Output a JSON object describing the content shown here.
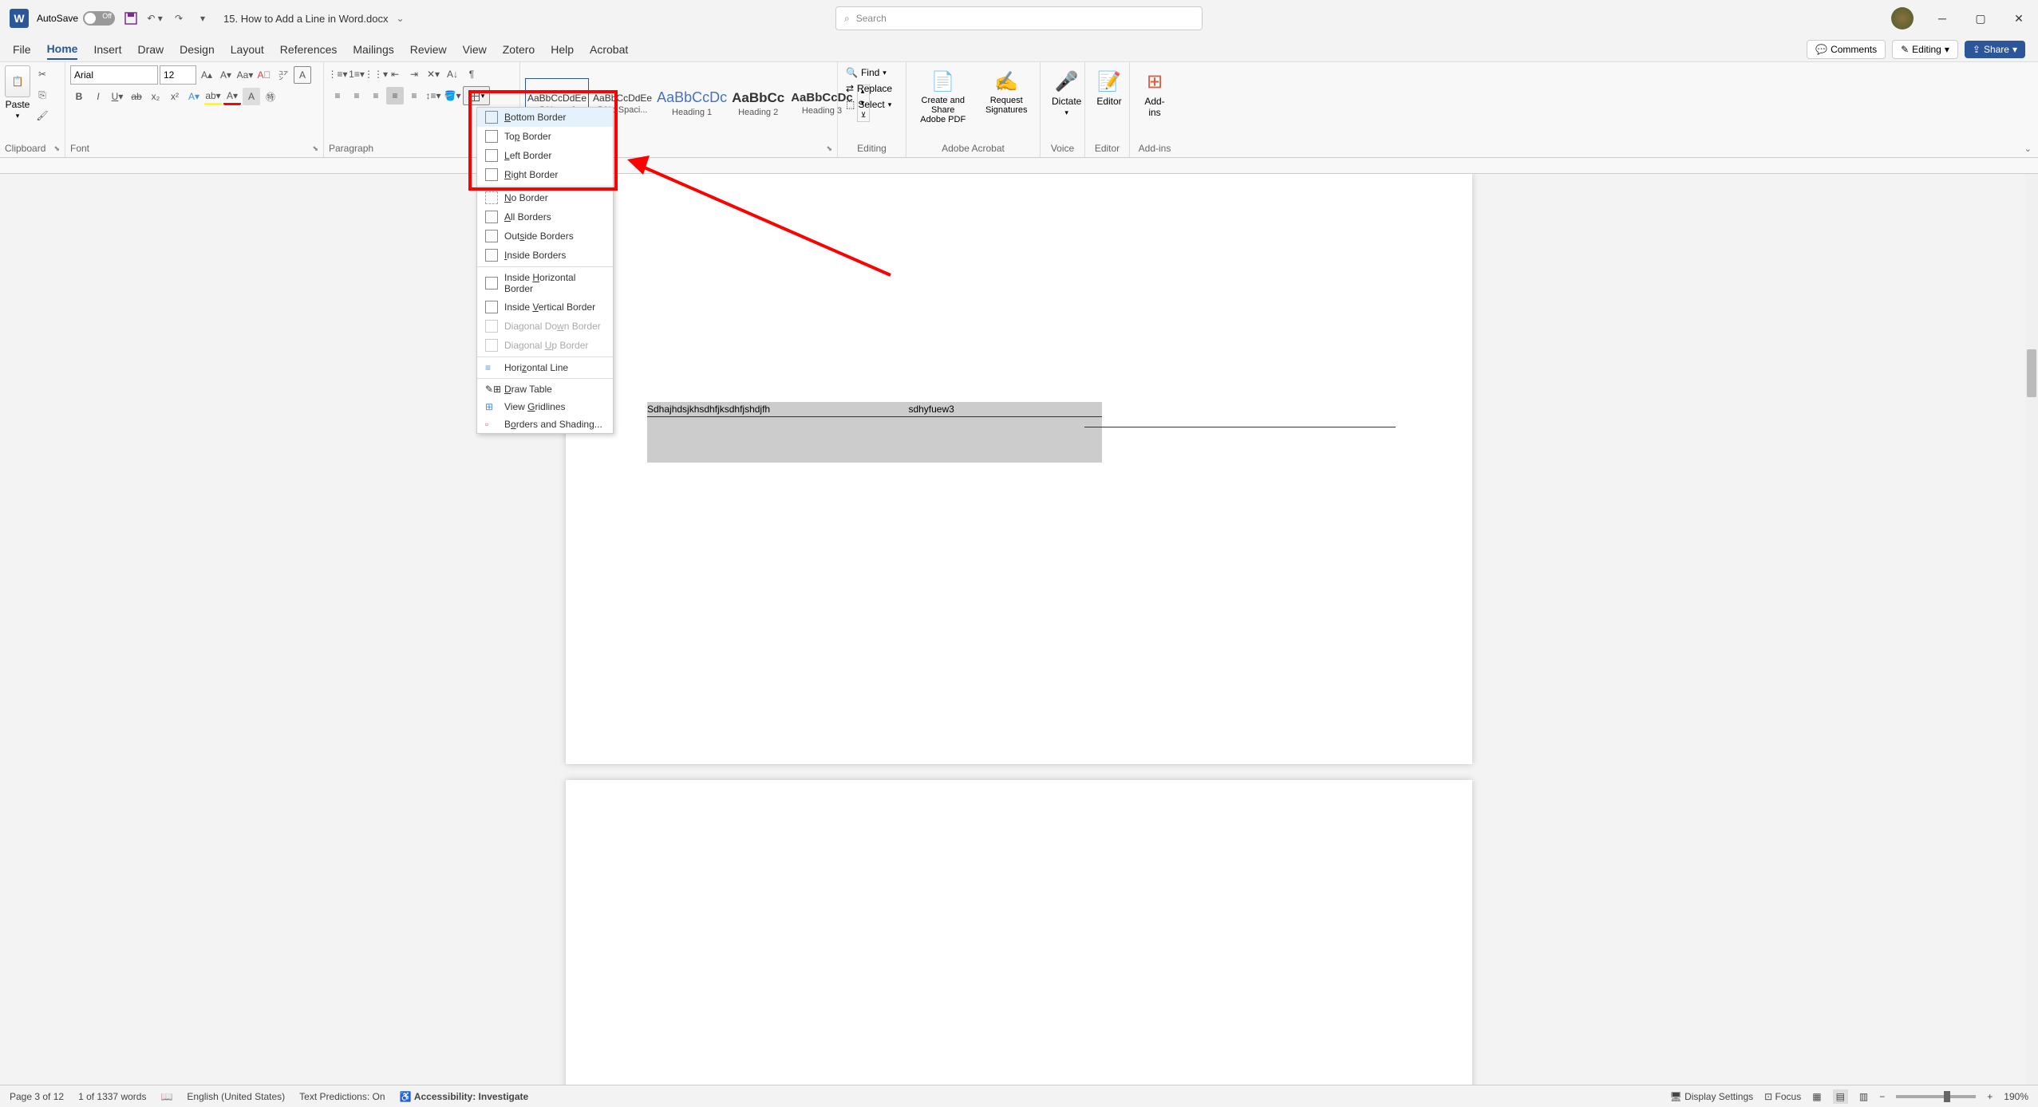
{
  "titlebar": {
    "autosave_label": "AutoSave",
    "autosave_state": "Off",
    "doc_title": "15. How to Add a Line in Word.docx",
    "search_placeholder": "Search"
  },
  "tabs": {
    "file": "File",
    "home": "Home",
    "insert": "Insert",
    "draw": "Draw",
    "design": "Design",
    "layout": "Layout",
    "references": "References",
    "mailings": "Mailings",
    "review": "Review",
    "view": "View",
    "zotero": "Zotero",
    "help": "Help",
    "acrobat": "Acrobat",
    "comments": "Comments",
    "editing": "Editing",
    "share": "Share"
  },
  "ribbon": {
    "clipboard": {
      "label": "Clipboard",
      "paste": "Paste"
    },
    "font": {
      "label": "Font",
      "name": "Arial",
      "size": "12"
    },
    "paragraph": {
      "label": "Paragraph"
    },
    "styles": {
      "label": "Styles",
      "preview": "AaBbCcDdEe",
      "preview3": "AaBbCcDc",
      "preview4": "AaBbCc",
      "preview5": "AaBbCcDc",
      "normal": "¶ Normal",
      "nospacing": "¶ No Spaci...",
      "heading1": "Heading 1",
      "heading2": "Heading 2",
      "heading3": "Heading 3"
    },
    "editing": {
      "label": "Editing",
      "find": "Find",
      "replace": "Replace",
      "select": "Select"
    },
    "acrobat": {
      "label": "Adobe Acrobat",
      "create": "Create and Share Adobe PDF",
      "sign": "Request Signatures"
    },
    "voice": {
      "label": "Voice",
      "dictate": "Dictate"
    },
    "editor": {
      "label": "Editor",
      "editor": "Editor"
    },
    "addins": {
      "label": "Add-ins",
      "addins": "Add-ins"
    }
  },
  "border_menu": {
    "bottom": "Bottom Border",
    "top": "Top Border",
    "left": "Left Border",
    "right": "Right Border",
    "none": "No Border",
    "all": "All Borders",
    "outside": "Outside Borders",
    "inside": "Inside Borders",
    "inside_h": "Inside Horizontal Border",
    "inside_v": "Inside Vertical Border",
    "diag_down": "Diagonal Down Border",
    "diag_up": "Diagonal Up Border",
    "hline": "Horizontal Line",
    "draw": "Draw Table",
    "grid": "View Gridlines",
    "borders_shading": "Borders and Shading..."
  },
  "document": {
    "text_part1": "Sdhajhdsjkhsdhfjksdhfjshdjfh",
    "text_part2": "sdhyfuew3"
  },
  "statusbar": {
    "page": "Page 3 of 12",
    "words": "1 of 1337 words",
    "language": "English (United States)",
    "predictions": "Text Predictions: On",
    "accessibility": "Accessibility: Investigate",
    "display": "Display Settings",
    "focus": "Focus",
    "zoom": "190%"
  }
}
